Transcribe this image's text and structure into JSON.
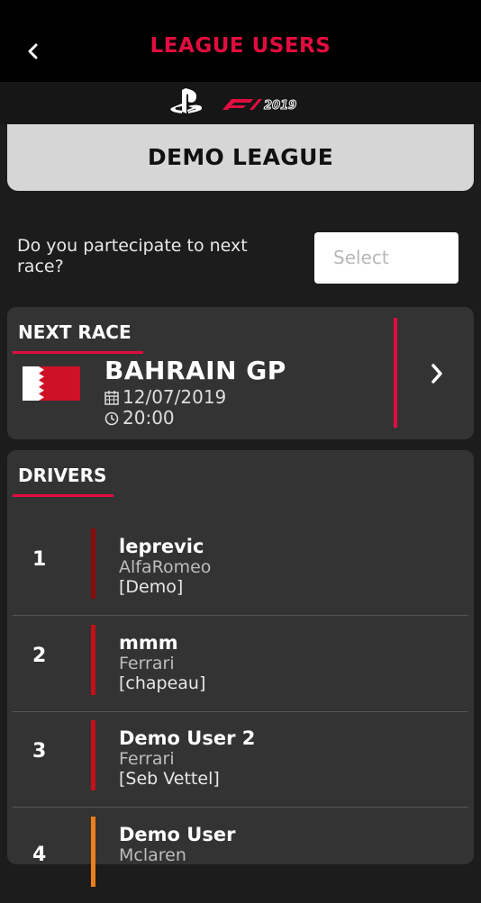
{
  "header": {
    "title": "LEAGUE USERS",
    "back_icon": "chevron-left-icon"
  },
  "brand": {
    "platform_icon": "playstation-logo-icon",
    "game_logo": "F1 2019"
  },
  "league": {
    "name": "DEMO LEAGUE"
  },
  "participation": {
    "question": "Do you partecipate to next race?",
    "select_placeholder": "Select"
  },
  "next_race": {
    "section_title": "NEXT RACE",
    "flag_icon": "bahrain-flag-icon",
    "name": "BAHRAIN GP",
    "date": "12/07/2019",
    "time": "20:00",
    "open_icon": "chevron-right-icon"
  },
  "drivers": {
    "section_title": "DRIVERS",
    "rows": [
      {
        "position": "1",
        "name": "leprevic",
        "team": "AlfaRomeo",
        "tag": "[Demo]",
        "team_color": "#8a0b0b"
      },
      {
        "position": "2",
        "name": "mmm",
        "team": "Ferrari",
        "tag": "[chapeau]",
        "team_color": "#c3101a"
      },
      {
        "position": "3",
        "name": "Demo User 2",
        "team": "Ferrari",
        "tag": "[Seb Vettel]",
        "team_color": "#c3101a"
      },
      {
        "position": "4",
        "name": "Demo User",
        "team": "Mclaren",
        "tag": "",
        "team_color": "#f07f1a"
      }
    ]
  },
  "colors": {
    "accent": "#e10d3f",
    "background": "#1c1c1c",
    "card": "#333333"
  }
}
